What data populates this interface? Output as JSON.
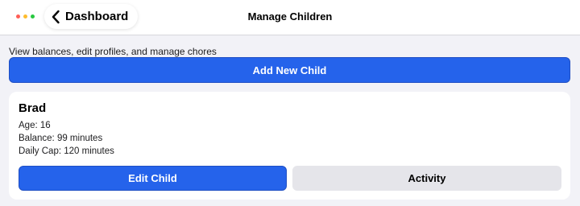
{
  "header": {
    "back_label": "Dashboard",
    "title": "Manage Children",
    "back_icon": "chevron-left-icon",
    "window_controls": [
      "#ff5f57",
      "#febc2e",
      "#28c840"
    ]
  },
  "main": {
    "subtitle": "View balances, edit profiles, and manage chores",
    "add_button_label": "Add New Child",
    "children": [
      {
        "name": "Brad",
        "age_line": "Age: 16",
        "balance_line": "Balance: 99 minutes",
        "cap_line": "Daily Cap: 120 minutes",
        "edit_label": "Edit Child",
        "activity_label": "Activity"
      }
    ]
  },
  "colors": {
    "accent": "#2563eb",
    "secondary_button": "#e5e5ea",
    "background": "#f2f2f7"
  }
}
